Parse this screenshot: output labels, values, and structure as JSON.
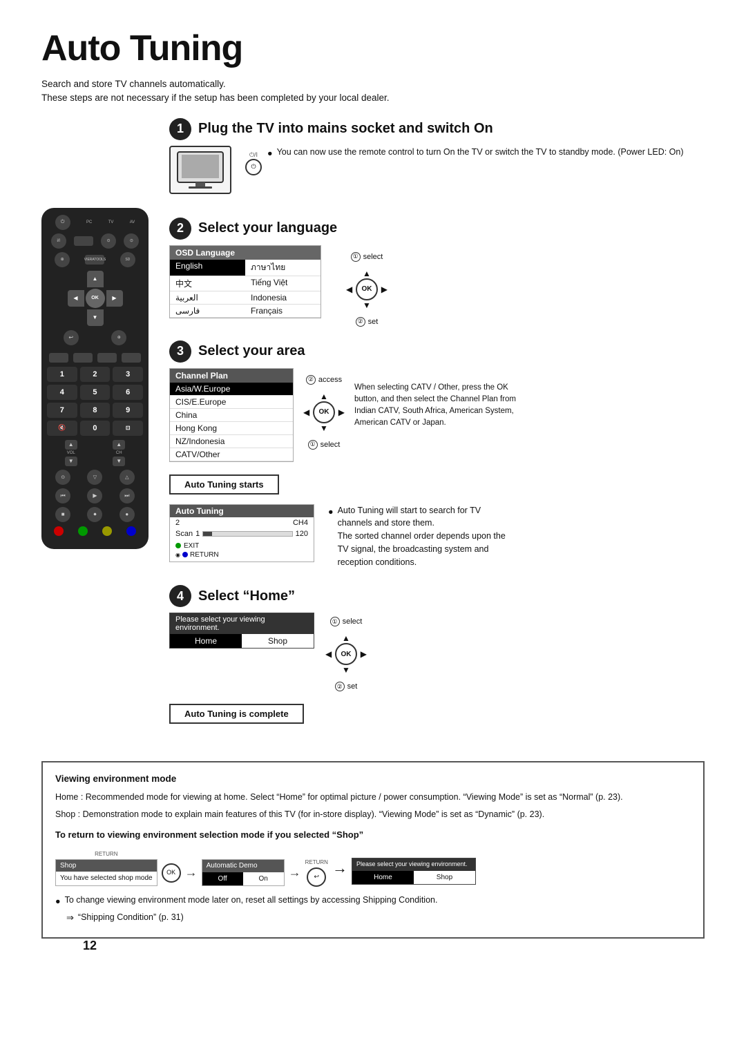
{
  "page": {
    "title": "Auto Tuning",
    "page_number": "12",
    "intro": [
      "Search and store TV channels automatically.",
      "These steps are not necessary if the setup has been completed by your local dealer."
    ]
  },
  "steps": {
    "step1": {
      "number": "1",
      "title": "Plug the TV into mains socket and switch On",
      "desc": "You can now use the remote control to turn On the TV or switch the TV to standby mode. (Power LED: On)"
    },
    "step2": {
      "number": "2",
      "title": "Select your language",
      "osd_label": "OSD Language",
      "osd_languages": [
        [
          "English",
          "ภาษาไทย"
        ],
        [
          "中文",
          "Tiếng Việt"
        ],
        [
          "العربية",
          "Indonesia"
        ],
        [
          "فارسی",
          "Français"
        ]
      ],
      "select_label": "① select",
      "set_label": "② set"
    },
    "step3": {
      "number": "3",
      "title": "Select your area",
      "channel_plan_label": "Channel Plan",
      "areas": [
        "Asia/W.Europe",
        "CIS/E.Europe",
        "China",
        "Hong Kong",
        "NZ/Indonesia",
        "CATV/Other"
      ],
      "access_label": "② access",
      "select_label": "① select",
      "auto_tuning_btn": "Auto Tuning starts",
      "catv_note": "When selecting CATV / Other, press the OK button, and then select the Channel Plan from Indian CATV, South Africa, American System, American CATV or Japan.",
      "auto_tuning_box": {
        "header": "Auto Tuning",
        "ch_label": "CH4",
        "scan_label": "Scan",
        "num1": "1",
        "num2": "120",
        "exit_label": "EXIT",
        "return_label": "RETURN"
      },
      "store_desc": "Auto Tuning will start to search for TV channels and store them.\nThe sorted channel order depends upon the TV signal, the broadcasting system and reception conditions."
    },
    "step4": {
      "number": "4",
      "title": "Select “Home”",
      "select_header": "Please select your viewing environment.",
      "options": [
        "Home",
        "Shop"
      ],
      "select_label": "① select",
      "set_label": "② set",
      "auto_complete_btn": "Auto Tuning is complete"
    }
  },
  "note_box": {
    "title": "Viewing environment mode",
    "home_desc": "Home : Recommended mode for viewing at home. Select “Home” for optimal picture / power consumption. “Viewing Mode” is set as “Normal” (p. 23).",
    "shop_desc": "Shop : Demonstration mode to explain main features of this TV (for in-store display). “Viewing Mode” is set as “Dynamic” (p. 23).",
    "return_bold": "To return to viewing environment selection mode if you selected “Shop”",
    "return_label": "RETURN",
    "shop_box_header": "Shop",
    "shop_box_content": "You have selected shop mode",
    "auto_demo_header": "Automatic Demo",
    "auto_demo_off": "Off",
    "auto_demo_on": "On",
    "select_header2": "Please select your viewing environment.",
    "home_label": "Home",
    "shop_label": "Shop",
    "bullet1": "To change viewing environment mode later on, reset all settings by accessing Shipping Condition.",
    "bullet2": "“Shipping Condition” (p. 31)"
  }
}
